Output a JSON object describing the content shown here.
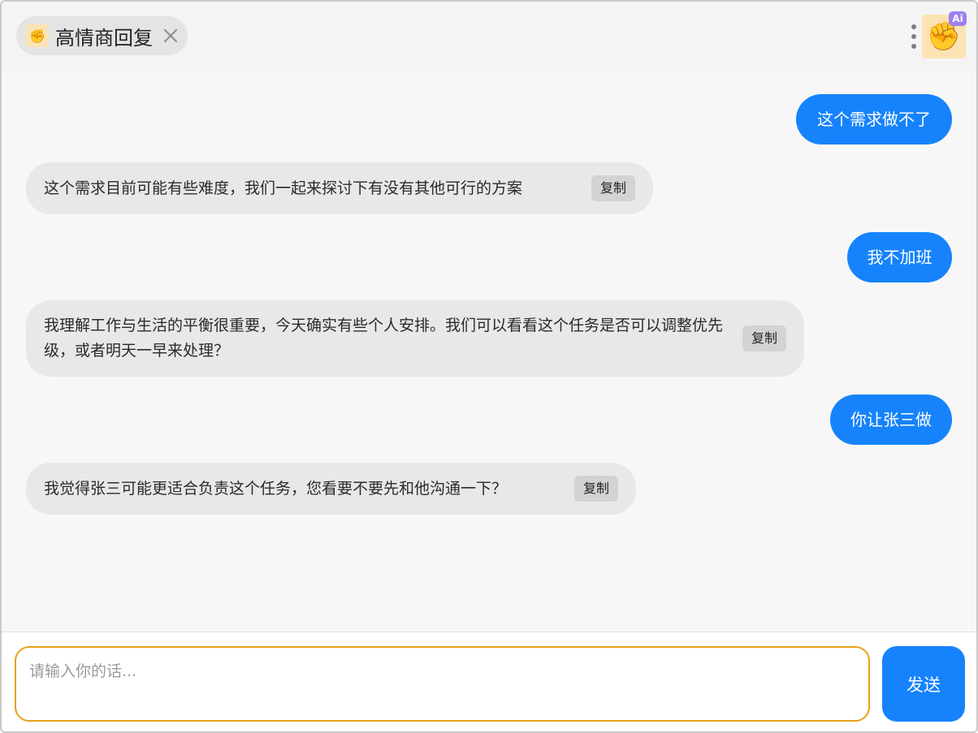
{
  "header": {
    "app_title": "高情商回复",
    "app_icon": "raised-fist-icon",
    "ai_badge": "Ai"
  },
  "messages": [
    {
      "role": "user",
      "text": "这个需求做不了"
    },
    {
      "role": "bot",
      "text": "这个需求目前可能有些难度，我们一起来探讨下有没有其他可行的方案",
      "copy_label": "复制"
    },
    {
      "role": "user",
      "text": "我不加班"
    },
    {
      "role": "bot",
      "text": "我理解工作与生活的平衡很重要，今天确实有些个人安排。我们可以看看这个任务是否可以调整优先级，或者明天一早来处理？",
      "copy_label": "复制"
    },
    {
      "role": "user",
      "text": "你让张三做"
    },
    {
      "role": "bot",
      "text": "我觉得张三可能更适合负责这个任务，您看要不要先和他沟通一下？",
      "copy_label": "复制"
    }
  ],
  "input": {
    "placeholder": "请输入你的话...",
    "value": ""
  },
  "send_label": "发送",
  "colors": {
    "accent": "#1683fc",
    "input_border": "#e6a117",
    "bot_bubble": "#e8e8ea",
    "ai_badge": "#9d7ff2"
  }
}
